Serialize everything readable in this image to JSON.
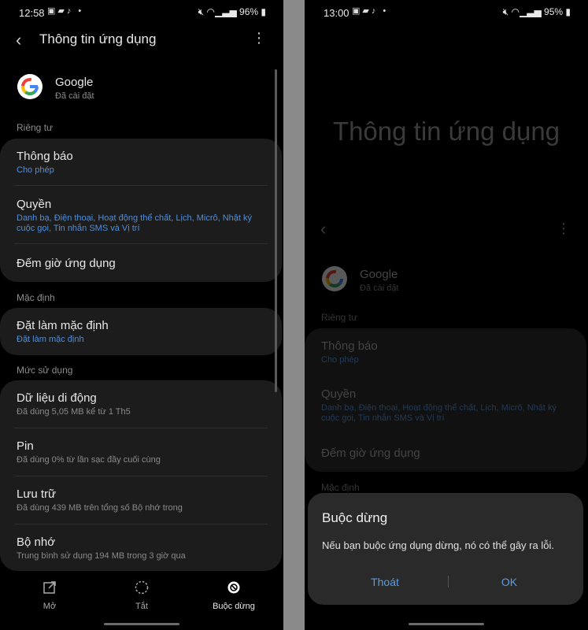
{
  "left": {
    "status": {
      "time": "12:58",
      "battery": "96%"
    },
    "header": {
      "title": "Thông tin ứng dụng"
    },
    "app": {
      "name": "Google",
      "status": "Đã cài đặt"
    },
    "sections": {
      "privacy": "Riêng tư",
      "default": "Mặc định",
      "usage": "Mức sử dụng"
    },
    "items": {
      "notifications": {
        "title": "Thông báo",
        "sub": "Cho phép"
      },
      "permissions": {
        "title": "Quyền",
        "sub": "Danh bạ, Điện thoại, Hoạt động thể chất, Lịch, Micrô, Nhật ký cuộc gọi, Tin nhắn SMS và Vị trí"
      },
      "screen_time": {
        "title": "Đếm giờ ứng dụng"
      },
      "set_default": {
        "title": "Đặt làm mặc định",
        "sub": "Đặt làm mặc định"
      },
      "mobile_data": {
        "title": "Dữ liệu di động",
        "sub": "Đã dùng 5,05 MB kể từ 1 Th5"
      },
      "battery": {
        "title": "Pin",
        "sub": "Đã dùng 0% từ lần sạc đầy cuối cùng"
      },
      "storage": {
        "title": "Lưu trữ",
        "sub": "Đã dùng 439 MB trên tổng số Bộ nhớ trong"
      },
      "memory": {
        "title": "Bộ nhớ",
        "sub": "Trung bình sử dụng 194 MB trong 3 giờ qua"
      }
    },
    "bottom": {
      "open": "Mở",
      "disable": "Tắt",
      "force_stop": "Buộc dừng"
    }
  },
  "right": {
    "status": {
      "time": "13:00",
      "battery": "95%"
    },
    "big_title": "Thông tin ứng dụng",
    "app": {
      "name": "Google",
      "status": "Đã cài đặt"
    },
    "sections": {
      "privacy": "Riêng tư",
      "default": "Mặc định"
    },
    "items": {
      "notifications": {
        "title": "Thông báo",
        "sub": "Cho phép"
      },
      "permissions": {
        "title": "Quyền",
        "sub": "Danh bạ, Điện thoại, Hoạt động thể chất, Lịch, Micrô, Nhật ký cuộc gọi, Tin nhắn SMS và Vị trí"
      },
      "screen_time": {
        "title": "Đếm giờ ứng dụng"
      }
    },
    "dialog": {
      "title": "Buộc dừng",
      "message": "Nếu bạn buộc ứng dụng dừng, nó có thể gây ra lỗi.",
      "cancel": "Thoát",
      "ok": "OK"
    }
  },
  "colors": {
    "accent": "#5a9ee8",
    "sub_blue": "#4f8ed9",
    "card": "#1c1c1c",
    "dialog": "#2a2a2a"
  }
}
